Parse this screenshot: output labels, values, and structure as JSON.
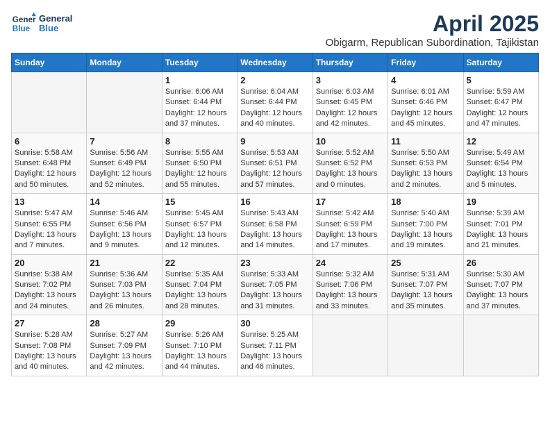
{
  "header": {
    "logo_general": "General",
    "logo_blue": "Blue",
    "month_title": "April 2025",
    "location": "Obigarm, Republican Subordination, Tajikistan"
  },
  "weekdays": [
    "Sunday",
    "Monday",
    "Tuesday",
    "Wednesday",
    "Thursday",
    "Friday",
    "Saturday"
  ],
  "weeks": [
    [
      {
        "day": "",
        "sunrise": "",
        "sunset": "",
        "daylight": ""
      },
      {
        "day": "",
        "sunrise": "",
        "sunset": "",
        "daylight": ""
      },
      {
        "day": "1",
        "sunrise": "Sunrise: 6:06 AM",
        "sunset": "Sunset: 6:44 PM",
        "daylight": "Daylight: 12 hours and 37 minutes."
      },
      {
        "day": "2",
        "sunrise": "Sunrise: 6:04 AM",
        "sunset": "Sunset: 6:44 PM",
        "daylight": "Daylight: 12 hours and 40 minutes."
      },
      {
        "day": "3",
        "sunrise": "Sunrise: 6:03 AM",
        "sunset": "Sunset: 6:45 PM",
        "daylight": "Daylight: 12 hours and 42 minutes."
      },
      {
        "day": "4",
        "sunrise": "Sunrise: 6:01 AM",
        "sunset": "Sunset: 6:46 PM",
        "daylight": "Daylight: 12 hours and 45 minutes."
      },
      {
        "day": "5",
        "sunrise": "Sunrise: 5:59 AM",
        "sunset": "Sunset: 6:47 PM",
        "daylight": "Daylight: 12 hours and 47 minutes."
      }
    ],
    [
      {
        "day": "6",
        "sunrise": "Sunrise: 5:58 AM",
        "sunset": "Sunset: 6:48 PM",
        "daylight": "Daylight: 12 hours and 50 minutes."
      },
      {
        "day": "7",
        "sunrise": "Sunrise: 5:56 AM",
        "sunset": "Sunset: 6:49 PM",
        "daylight": "Daylight: 12 hours and 52 minutes."
      },
      {
        "day": "8",
        "sunrise": "Sunrise: 5:55 AM",
        "sunset": "Sunset: 6:50 PM",
        "daylight": "Daylight: 12 hours and 55 minutes."
      },
      {
        "day": "9",
        "sunrise": "Sunrise: 5:53 AM",
        "sunset": "Sunset: 6:51 PM",
        "daylight": "Daylight: 12 hours and 57 minutes."
      },
      {
        "day": "10",
        "sunrise": "Sunrise: 5:52 AM",
        "sunset": "Sunset: 6:52 PM",
        "daylight": "Daylight: 13 hours and 0 minutes."
      },
      {
        "day": "11",
        "sunrise": "Sunrise: 5:50 AM",
        "sunset": "Sunset: 6:53 PM",
        "daylight": "Daylight: 13 hours and 2 minutes."
      },
      {
        "day": "12",
        "sunrise": "Sunrise: 5:49 AM",
        "sunset": "Sunset: 6:54 PM",
        "daylight": "Daylight: 13 hours and 5 minutes."
      }
    ],
    [
      {
        "day": "13",
        "sunrise": "Sunrise: 5:47 AM",
        "sunset": "Sunset: 6:55 PM",
        "daylight": "Daylight: 13 hours and 7 minutes."
      },
      {
        "day": "14",
        "sunrise": "Sunrise: 5:46 AM",
        "sunset": "Sunset: 6:56 PM",
        "daylight": "Daylight: 13 hours and 9 minutes."
      },
      {
        "day": "15",
        "sunrise": "Sunrise: 5:45 AM",
        "sunset": "Sunset: 6:57 PM",
        "daylight": "Daylight: 13 hours and 12 minutes."
      },
      {
        "day": "16",
        "sunrise": "Sunrise: 5:43 AM",
        "sunset": "Sunset: 6:58 PM",
        "daylight": "Daylight: 13 hours and 14 minutes."
      },
      {
        "day": "17",
        "sunrise": "Sunrise: 5:42 AM",
        "sunset": "Sunset: 6:59 PM",
        "daylight": "Daylight: 13 hours and 17 minutes."
      },
      {
        "day": "18",
        "sunrise": "Sunrise: 5:40 AM",
        "sunset": "Sunset: 7:00 PM",
        "daylight": "Daylight: 13 hours and 19 minutes."
      },
      {
        "day": "19",
        "sunrise": "Sunrise: 5:39 AM",
        "sunset": "Sunset: 7:01 PM",
        "daylight": "Daylight: 13 hours and 21 minutes."
      }
    ],
    [
      {
        "day": "20",
        "sunrise": "Sunrise: 5:38 AM",
        "sunset": "Sunset: 7:02 PM",
        "daylight": "Daylight: 13 hours and 24 minutes."
      },
      {
        "day": "21",
        "sunrise": "Sunrise: 5:36 AM",
        "sunset": "Sunset: 7:03 PM",
        "daylight": "Daylight: 13 hours and 26 minutes."
      },
      {
        "day": "22",
        "sunrise": "Sunrise: 5:35 AM",
        "sunset": "Sunset: 7:04 PM",
        "daylight": "Daylight: 13 hours and 28 minutes."
      },
      {
        "day": "23",
        "sunrise": "Sunrise: 5:33 AM",
        "sunset": "Sunset: 7:05 PM",
        "daylight": "Daylight: 13 hours and 31 minutes."
      },
      {
        "day": "24",
        "sunrise": "Sunrise: 5:32 AM",
        "sunset": "Sunset: 7:06 PM",
        "daylight": "Daylight: 13 hours and 33 minutes."
      },
      {
        "day": "25",
        "sunrise": "Sunrise: 5:31 AM",
        "sunset": "Sunset: 7:07 PM",
        "daylight": "Daylight: 13 hours and 35 minutes."
      },
      {
        "day": "26",
        "sunrise": "Sunrise: 5:30 AM",
        "sunset": "Sunset: 7:07 PM",
        "daylight": "Daylight: 13 hours and 37 minutes."
      }
    ],
    [
      {
        "day": "27",
        "sunrise": "Sunrise: 5:28 AM",
        "sunset": "Sunset: 7:08 PM",
        "daylight": "Daylight: 13 hours and 40 minutes."
      },
      {
        "day": "28",
        "sunrise": "Sunrise: 5:27 AM",
        "sunset": "Sunset: 7:09 PM",
        "daylight": "Daylight: 13 hours and 42 minutes."
      },
      {
        "day": "29",
        "sunrise": "Sunrise: 5:26 AM",
        "sunset": "Sunset: 7:10 PM",
        "daylight": "Daylight: 13 hours and 44 minutes."
      },
      {
        "day": "30",
        "sunrise": "Sunrise: 5:25 AM",
        "sunset": "Sunset: 7:11 PM",
        "daylight": "Daylight: 13 hours and 46 minutes."
      },
      {
        "day": "",
        "sunrise": "",
        "sunset": "",
        "daylight": ""
      },
      {
        "day": "",
        "sunrise": "",
        "sunset": "",
        "daylight": ""
      },
      {
        "day": "",
        "sunrise": "",
        "sunset": "",
        "daylight": ""
      }
    ]
  ]
}
